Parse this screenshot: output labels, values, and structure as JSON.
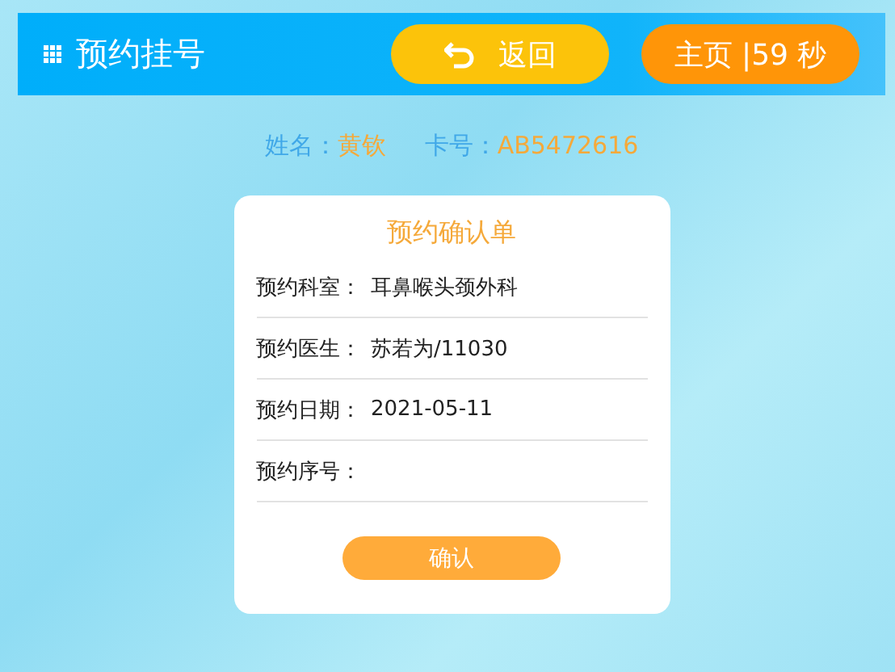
{
  "header": {
    "title": "预约挂号",
    "back_button": "返回",
    "home_button": "主页 |59 秒"
  },
  "patient": {
    "name_label": "姓名：",
    "name": "黄钦",
    "card_label": "卡号：",
    "card": "AB5472616"
  },
  "form": {
    "title": "预约确认单",
    "rows": [
      {
        "label": "预约科室：",
        "value": "耳鼻喉头颈外科"
      },
      {
        "label": "预约医生：",
        "value": "苏若为/11030"
      },
      {
        "label": "预约日期：",
        "value": "2021-05-11"
      },
      {
        "label": "预约序号："
      }
    ],
    "confirm_button": "确认"
  }
}
